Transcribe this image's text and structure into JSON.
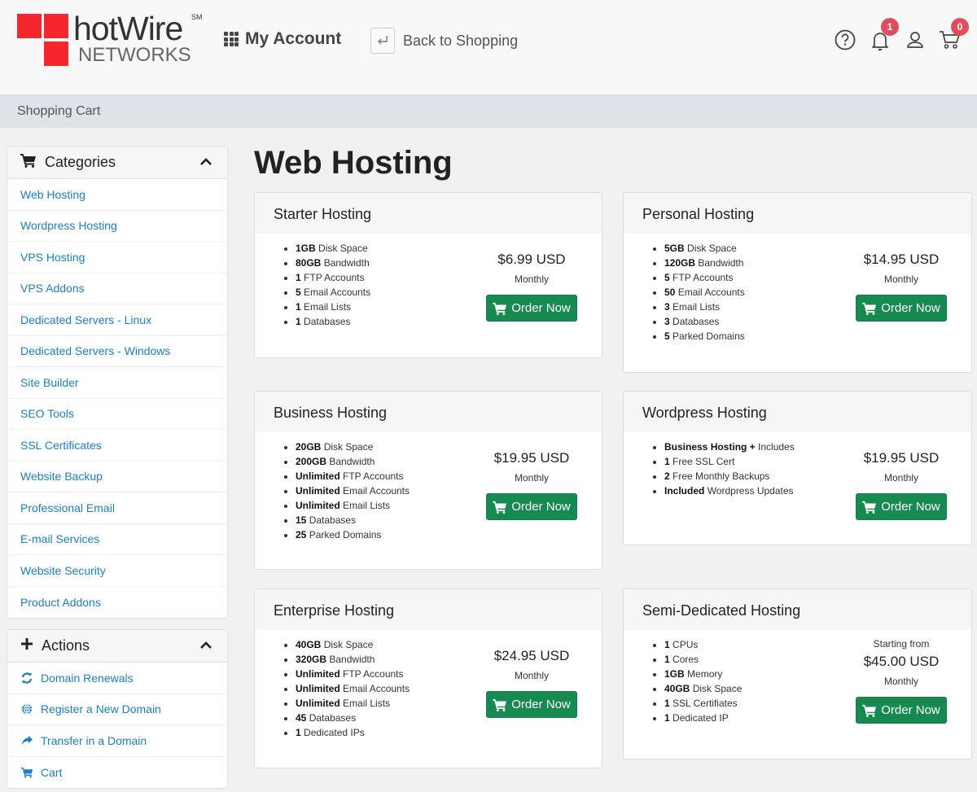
{
  "header": {
    "logo_brand": "hotWire",
    "logo_sub": "NETWORKS",
    "logo_mark": "SM",
    "my_account": "My Account",
    "back_to_shopping": "Back to Shopping",
    "notifications_count": "1",
    "cart_count": "0",
    "icons": [
      "help-icon",
      "bell-icon",
      "user-icon",
      "cart-icon"
    ]
  },
  "breadcrumb": "Shopping Cart",
  "sidebar": {
    "categories_title": "Categories",
    "categories": [
      "Web Hosting",
      "Wordpress Hosting",
      "VPS Hosting",
      "VPS Addons",
      "Dedicated Servers - Linux",
      "Dedicated Servers - Windows",
      "Site Builder",
      "SEO Tools",
      "SSL Certificates",
      "Website Backup",
      "Professional Email",
      "E-mail Services",
      "Website Security",
      "Product Addons"
    ],
    "actions_title": "Actions",
    "actions": [
      {
        "label": "Domain Renewals",
        "icon": "refresh-icon"
      },
      {
        "label": "Register a New Domain",
        "icon": "globe-icon"
      },
      {
        "label": "Transfer in a Domain",
        "icon": "share-icon"
      },
      {
        "label": "Cart",
        "icon": "cart-icon"
      }
    ]
  },
  "main": {
    "title": "Web Hosting",
    "order_label": "Order Now",
    "products": [
      {
        "name": "Starter Hosting",
        "features": [
          [
            "1GB",
            "Disk Space"
          ],
          [
            "80GB",
            "Bandwidth"
          ],
          [
            "1",
            "FTP Accounts"
          ],
          [
            "5",
            "Email Accounts"
          ],
          [
            "1",
            "Email Lists"
          ],
          [
            "1",
            "Databases"
          ]
        ],
        "starting": "",
        "price": "$6.99 USD",
        "cycle": "Monthly"
      },
      {
        "name": "Personal Hosting",
        "features": [
          [
            "5GB",
            "Disk Space"
          ],
          [
            "120GB",
            "Bandwidth"
          ],
          [
            "5",
            "FTP Accounts"
          ],
          [
            "50",
            "Email Accounts"
          ],
          [
            "3",
            "Email Lists"
          ],
          [
            "3",
            "Databases"
          ],
          [
            "5",
            "Parked Domains"
          ]
        ],
        "starting": "",
        "price": "$14.95 USD",
        "cycle": "Monthly"
      },
      {
        "name": "Business Hosting",
        "features": [
          [
            "20GB",
            "Disk Space"
          ],
          [
            "200GB",
            "Bandwidth"
          ],
          [
            "Unlimited",
            "FTP Accounts"
          ],
          [
            "Unlimited",
            "Email Accounts"
          ],
          [
            "Unlimited",
            "Email Lists"
          ],
          [
            "15",
            "Databases"
          ],
          [
            "25",
            "Parked Domains"
          ]
        ],
        "starting": "",
        "price": "$19.95 USD",
        "cycle": "Monthly"
      },
      {
        "name": "Wordpress Hosting",
        "features": [
          [
            "Business Hosting +",
            "Includes"
          ],
          [
            "1",
            "Free SSL Cert"
          ],
          [
            "2",
            "Free Monthly Backups"
          ],
          [
            "Included",
            "Wordpress Updates"
          ]
        ],
        "starting": "",
        "price": "$19.95 USD",
        "cycle": "Monthly"
      },
      {
        "name": "Enterprise Hosting",
        "features": [
          [
            "40GB",
            "Disk Space"
          ],
          [
            "320GB",
            "Bandwidth"
          ],
          [
            "Unlimited",
            "FTP Accounts"
          ],
          [
            "Unlimited",
            "Email Accounts"
          ],
          [
            "Unlimited",
            "Email Lists"
          ],
          [
            "45",
            "Databases"
          ],
          [
            "1",
            "Dedicated IPs"
          ]
        ],
        "starting": "",
        "price": "$24.95 USD",
        "cycle": "Monthly"
      },
      {
        "name": "Semi-Dedicated Hosting",
        "features": [
          [
            "1",
            "CPUs"
          ],
          [
            "1",
            "Cores"
          ],
          [
            "1GB",
            "Memory"
          ],
          [
            "40GB",
            "Disk Space"
          ],
          [
            "1",
            "SSL Certifiates"
          ],
          [
            "1",
            "Dedicated IP"
          ]
        ],
        "starting": "Starting from",
        "price": "$45.00 USD",
        "cycle": "Monthly"
      }
    ]
  },
  "colors": {
    "brand_red": "#f5262c",
    "link_blue": "#1a7fc4",
    "order_green": "#178a52",
    "badge_red": "#e04e5d"
  }
}
